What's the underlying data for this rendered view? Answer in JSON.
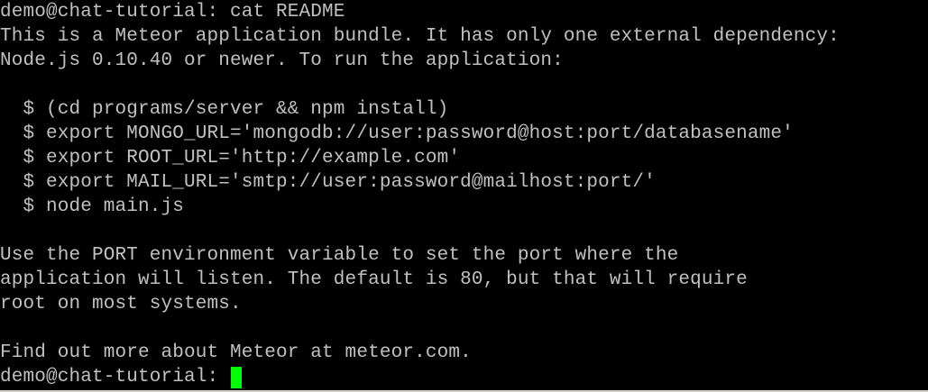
{
  "terminal": {
    "lines": [
      "demo@chat-tutorial: cat README",
      "This is a Meteor application bundle. It has only one external dependency:",
      "Node.js 0.10.40 or newer. To run the application:",
      "",
      "  $ (cd programs/server && npm install)",
      "  $ export MONGO_URL='mongodb://user:password@host:port/databasename'",
      "  $ export ROOT_URL='http://example.com'",
      "  $ export MAIL_URL='smtp://user:password@mailhost:port/'",
      "  $ node main.js",
      "",
      "Use the PORT environment variable to set the port where the",
      "application will listen. The default is 80, but that will require",
      "root on most systems.",
      "",
      "Find out more about Meteor at meteor.com."
    ],
    "prompt": "demo@chat-tutorial: ",
    "cursor_color": "#00ff00",
    "text_color": "#c0c0c0",
    "background_color": "#000000"
  }
}
